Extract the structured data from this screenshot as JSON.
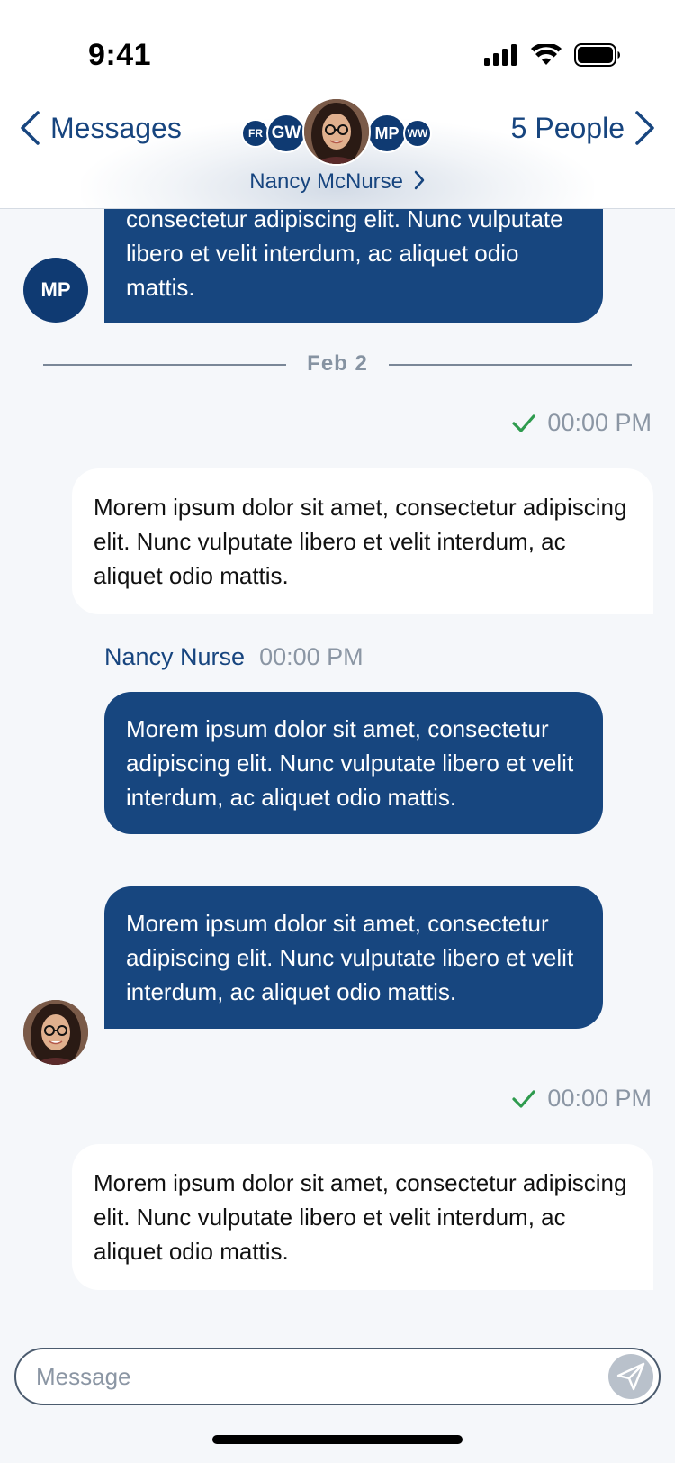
{
  "status_bar": {
    "time": "9:41"
  },
  "header": {
    "back_label": "Messages",
    "people_label": "5 People",
    "thread_name": "Nancy McNurse",
    "participants": [
      "FR",
      "GW",
      "MP",
      "WW"
    ]
  },
  "chat": {
    "messages": [
      {
        "text": "consectetur adipiscing elit. Nunc vulputate libero et velit interdum, ac aliquet odio mattis."
      },
      {
        "text": "Morem ipsum dolor sit amet, consectetur adipiscing elit. Nunc vulputate libero et velit interdum, ac aliquet odio mattis.",
        "time": "00:00 PM"
      },
      {
        "sender": "Nancy Nurse",
        "time": "00:00 PM",
        "text": "Morem ipsum dolor sit amet, consectetur adipiscing elit. Nunc vulputate libero et velit interdum, ac aliquet odio mattis."
      },
      {
        "text": "Morem ipsum dolor sit amet, consectetur adipiscing elit. Nunc vulputate libero et velit interdum, ac aliquet odio mattis."
      },
      {
        "text": "Morem ipsum dolor sit amet, consectetur adipiscing elit. Nunc vulputate libero et velit interdum, ac aliquet odio mattis.",
        "time": "00:00 PM"
      }
    ],
    "mp_avatar": "MP",
    "date_divider": "Feb 2"
  },
  "composer": {
    "placeholder": "Message"
  },
  "icons": {
    "back": "chevron-left-icon",
    "forward": "chevron-right-icon",
    "check": "check-icon",
    "send": "send-icon"
  },
  "colors": {
    "incoming_bubble": "#17467f",
    "outgoing_bubble": "#ffffff",
    "accent": "#17457f",
    "check": "#2e9b4e",
    "background": "#f5f7fa"
  }
}
